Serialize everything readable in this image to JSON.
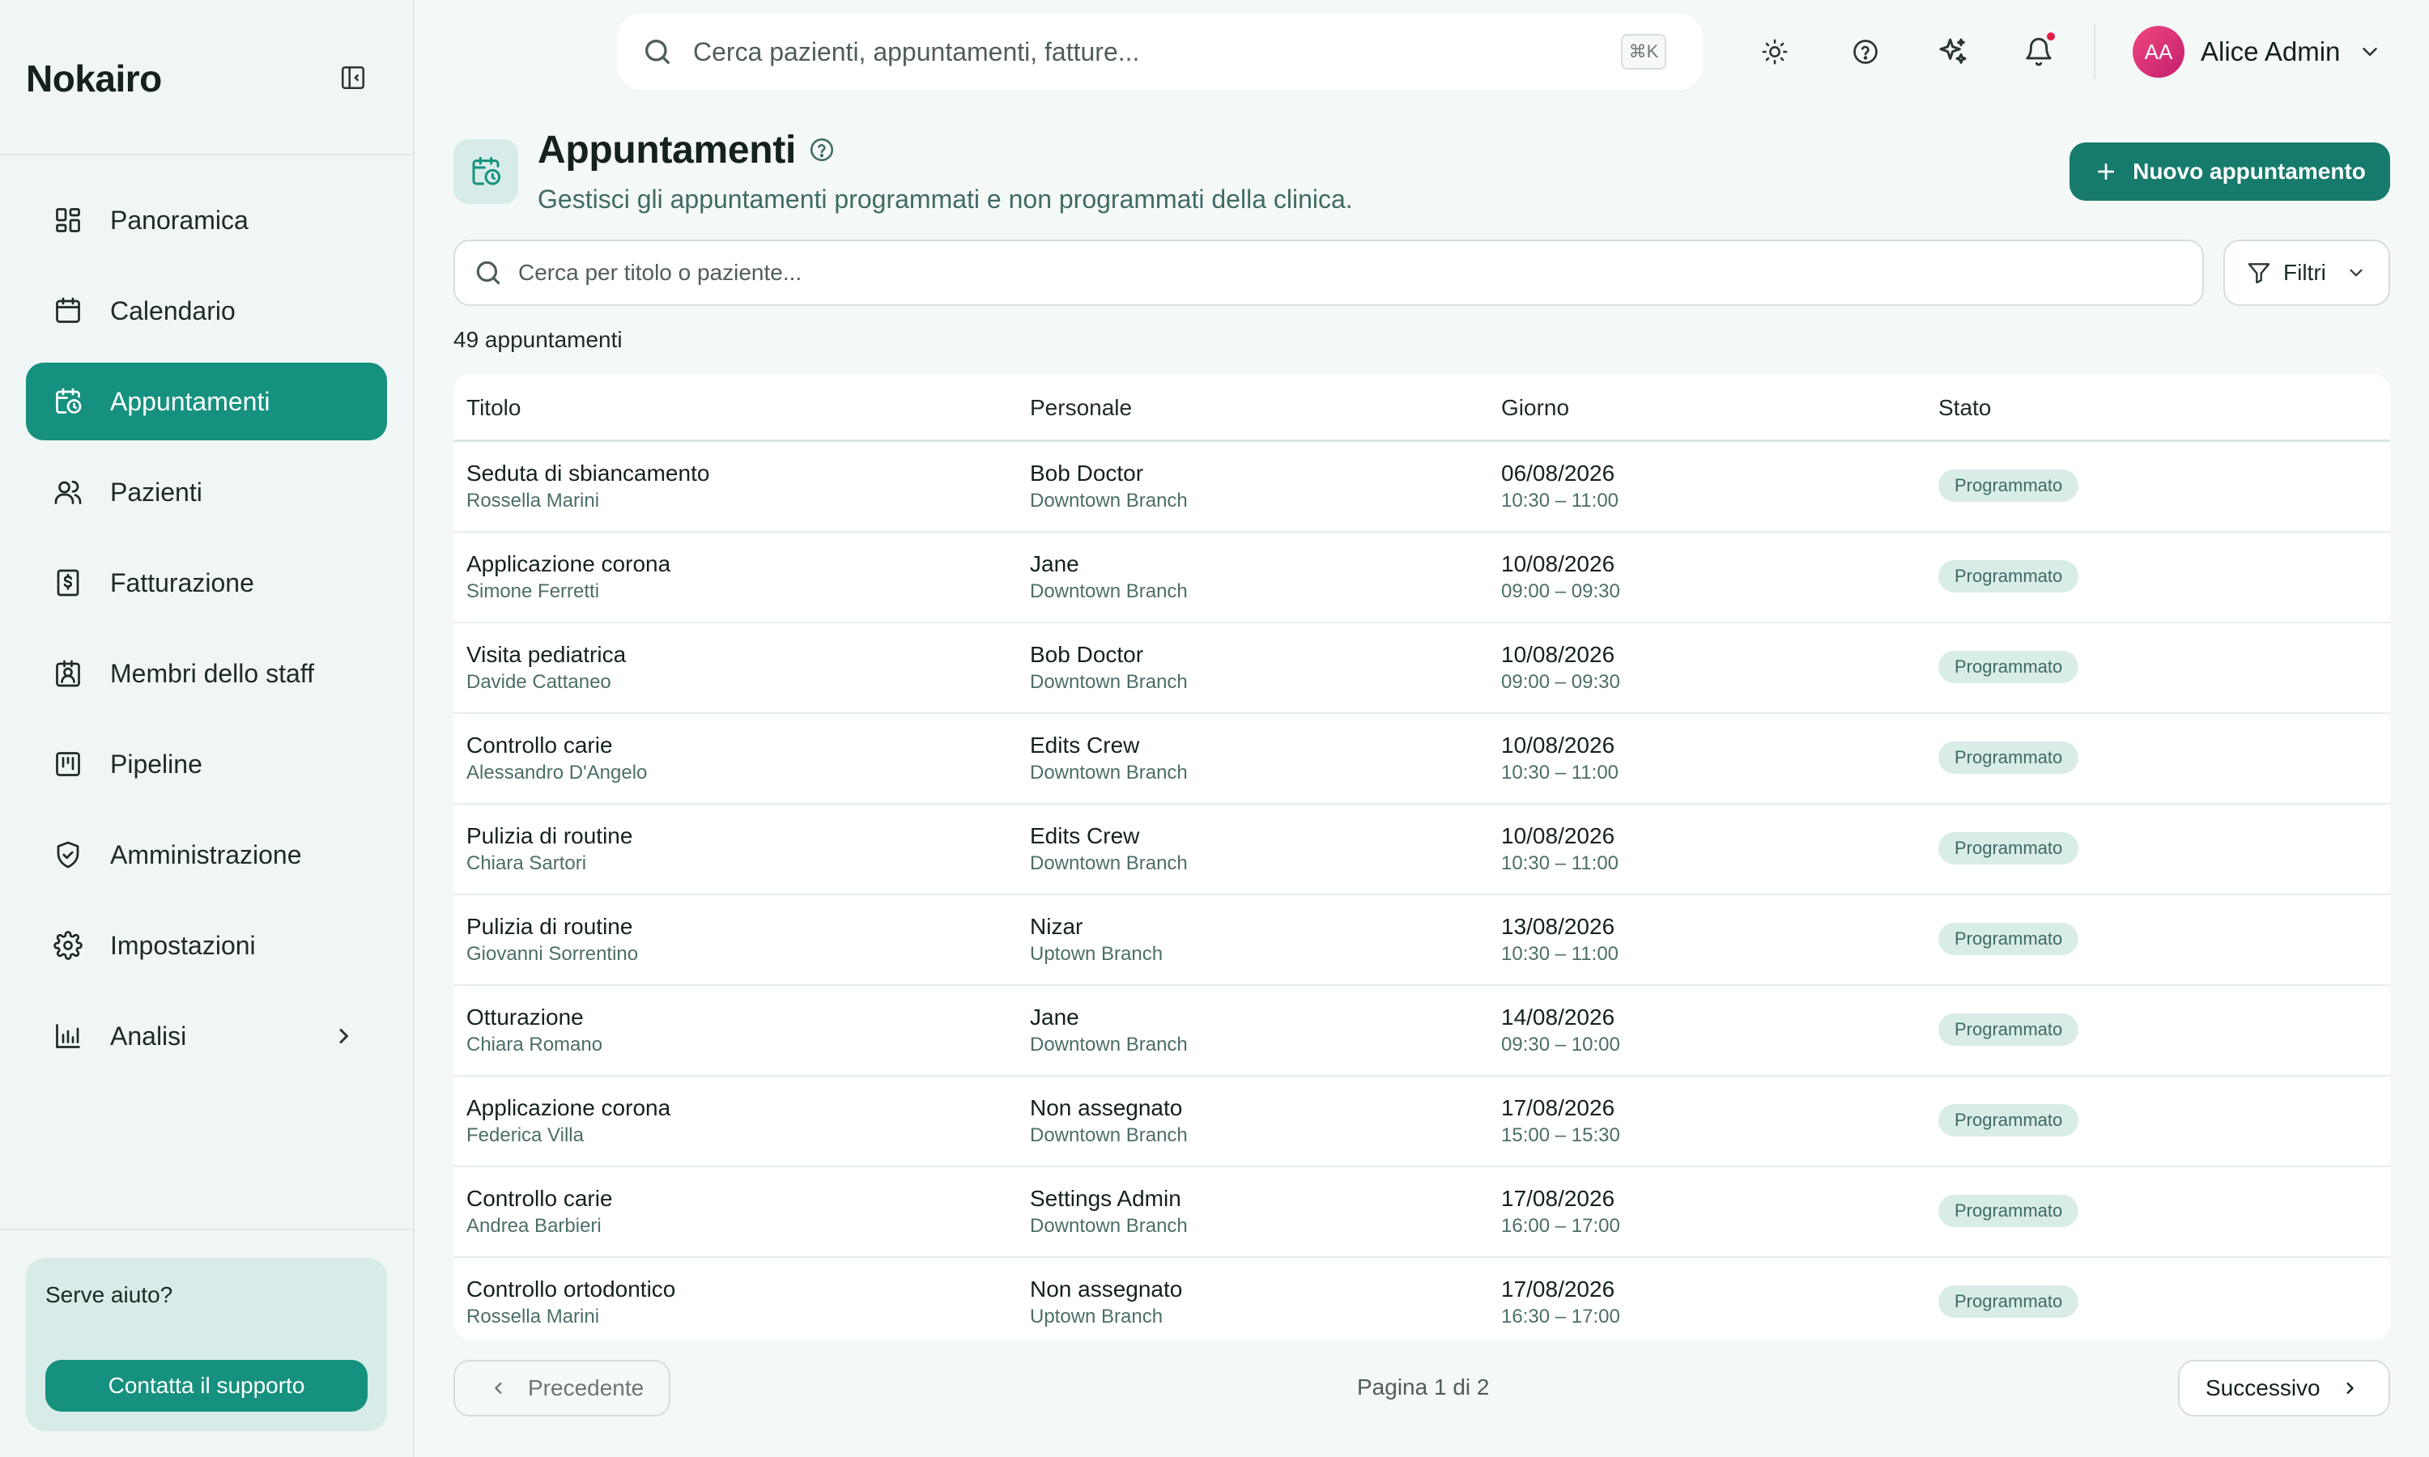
{
  "app": {
    "brand": "Nokairo"
  },
  "search": {
    "placeholder": "Cerca pazienti, appuntamenti, fatture...",
    "shortcut": "⌘K"
  },
  "user": {
    "initials": "AA",
    "name": "Alice Admin"
  },
  "sidebar": {
    "items": [
      {
        "label": "Panoramica",
        "icon": "dashboard-icon"
      },
      {
        "label": "Calendario",
        "icon": "calendar-icon"
      },
      {
        "label": "Appuntamenti",
        "icon": "calendar-clock-icon",
        "active": true
      },
      {
        "label": "Pazienti",
        "icon": "users-icon"
      },
      {
        "label": "Fatturazione",
        "icon": "invoice-icon"
      },
      {
        "label": "Membri dello staff",
        "icon": "staff-badge-icon"
      },
      {
        "label": "Pipeline",
        "icon": "kanban-icon"
      },
      {
        "label": "Amministrazione",
        "icon": "shield-check-icon"
      },
      {
        "label": "Impostazioni",
        "icon": "gear-icon"
      },
      {
        "label": "Analisi",
        "icon": "bar-chart-icon",
        "has_submenu": true
      }
    ],
    "help": {
      "title": "Serve aiuto?",
      "button": "Contatta il supporto"
    }
  },
  "page": {
    "title": "Appuntamenti",
    "subtitle": "Gestisci gli appuntamenti programmati e non programmati della clinica.",
    "new_button": "Nuovo appuntamento",
    "table_search_placeholder": "Cerca per titolo o paziente...",
    "filters_label": "Filtri",
    "count_label": "49 appuntamenti"
  },
  "table": {
    "columns": [
      "Titolo",
      "Personale",
      "Giorno",
      "Stato"
    ],
    "rows": [
      {
        "title": "Seduta di sbiancamento",
        "patient": "Rossella Marini",
        "staff": "Bob Doctor",
        "branch": "Downtown Branch",
        "date": "06/08/2026",
        "time": "10:30 – 11:00",
        "status": "Programmato"
      },
      {
        "title": "Applicazione corona",
        "patient": "Simone Ferretti",
        "staff": "Jane",
        "branch": "Downtown Branch",
        "date": "10/08/2026",
        "time": "09:00 – 09:30",
        "status": "Programmato"
      },
      {
        "title": "Visita pediatrica",
        "patient": "Davide Cattaneo",
        "staff": "Bob Doctor",
        "branch": "Downtown Branch",
        "date": "10/08/2026",
        "time": "09:00 – 09:30",
        "status": "Programmato"
      },
      {
        "title": "Controllo carie",
        "patient": "Alessandro D'Angelo",
        "staff": "Edits Crew",
        "branch": "Downtown Branch",
        "date": "10/08/2026",
        "time": "10:30 – 11:00",
        "status": "Programmato"
      },
      {
        "title": "Pulizia di routine",
        "patient": "Chiara Sartori",
        "staff": "Edits Crew",
        "branch": "Downtown Branch",
        "date": "10/08/2026",
        "time": "10:30 – 11:00",
        "status": "Programmato"
      },
      {
        "title": "Pulizia di routine",
        "patient": "Giovanni Sorrentino",
        "staff": "Nizar",
        "branch": "Uptown Branch",
        "date": "13/08/2026",
        "time": "10:30 – 11:00",
        "status": "Programmato"
      },
      {
        "title": "Otturazione",
        "patient": "Chiara Romano",
        "staff": "Jane",
        "branch": "Downtown Branch",
        "date": "14/08/2026",
        "time": "09:30 – 10:00",
        "status": "Programmato"
      },
      {
        "title": "Applicazione corona",
        "patient": "Federica Villa",
        "staff": "Non assegnato",
        "branch": "Downtown Branch",
        "date": "17/08/2026",
        "time": "15:00 – 15:30",
        "status": "Programmato"
      },
      {
        "title": "Controllo carie",
        "patient": "Andrea Barbieri",
        "staff": "Settings Admin",
        "branch": "Downtown Branch",
        "date": "17/08/2026",
        "time": "16:00 – 17:00",
        "status": "Programmato"
      },
      {
        "title": "Controllo ortodontico",
        "patient": "Rossella Marini",
        "staff": "Non assegnato",
        "branch": "Uptown Branch",
        "date": "17/08/2026",
        "time": "16:30 – 17:00",
        "status": "Programmato"
      }
    ]
  },
  "pagination": {
    "prev": "Precedente",
    "info": "Pagina 1 di 2",
    "next": "Successivo"
  },
  "colors": {
    "accent": "#16917f",
    "accent_dark": "#167a6c",
    "notification": "#e11d48"
  }
}
